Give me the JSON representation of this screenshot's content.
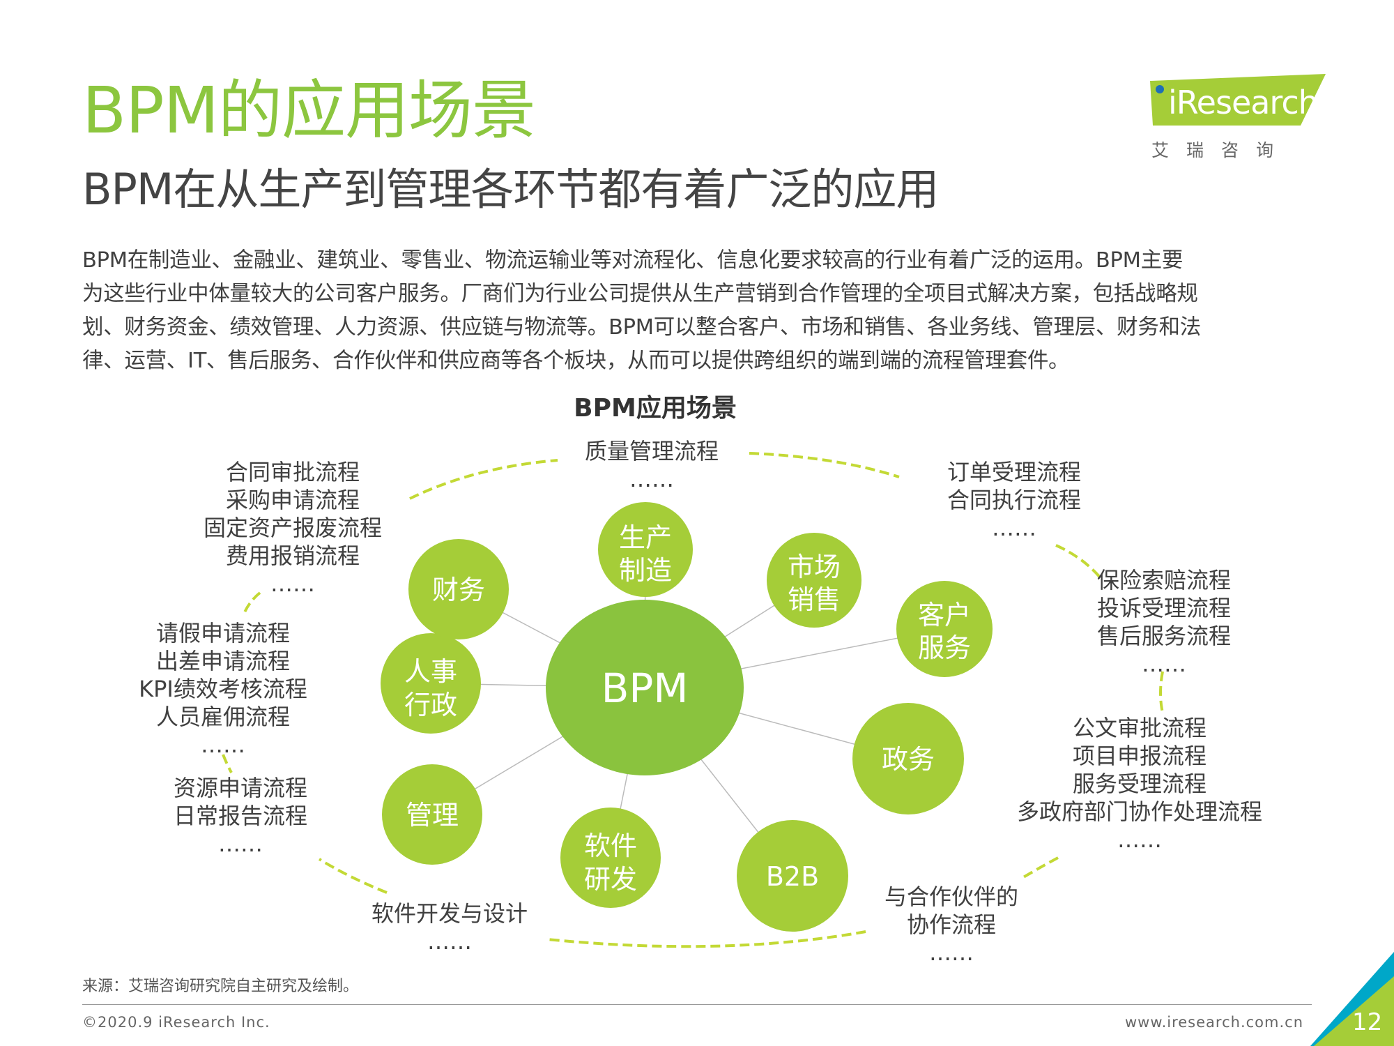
{
  "header": {
    "title": "BPM的应用场景",
    "subtitle": "BPM在从生产到管理各环节都有着广泛的应用"
  },
  "logo": {
    "brand": "iResearch",
    "chinese_name": "艾瑞咨询"
  },
  "body": {
    "lines": [
      "BPM在制造业、金融业、建筑业、零售业、物流运输业等对流程化、信息化要求较高的行业有着广泛的运用。BPM主要",
      "为这些行业中体量较大的公司客户服务。厂商们为行业公司提供从生产营销到合作管理的全项目式解决方案，包括战略规",
      "划、财务资金、绩效管理、人力资源、供应链与物流等。BPM可以整合客户、市场和销售、各业务线、管理层、财务和法",
      "律、运营、IT、售后服务、合作伙伴和供应商等各个板块，从而可以提供跨组织的端到端的流程管理套件。"
    ]
  },
  "diagram": {
    "title": "BPM应用场景",
    "hub": "BPM",
    "nodes": [
      {
        "id": "production",
        "label_lines": [
          "生产",
          "制造"
        ]
      },
      {
        "id": "marketing",
        "label_lines": [
          "市场",
          "销售"
        ]
      },
      {
        "id": "customer",
        "label_lines": [
          "客户",
          "服务"
        ]
      },
      {
        "id": "government",
        "label_lines": [
          "政务"
        ]
      },
      {
        "id": "b2b",
        "label_lines": [
          "B2B"
        ]
      },
      {
        "id": "software",
        "label_lines": [
          "软件",
          "研发"
        ]
      },
      {
        "id": "management",
        "label_lines": [
          "管理"
        ]
      },
      {
        "id": "hr",
        "label_lines": [
          "人事",
          "行政"
        ]
      },
      {
        "id": "finance",
        "label_lines": [
          "财务"
        ]
      }
    ],
    "process_groups": {
      "production": [
        "质量管理流程",
        "……"
      ],
      "marketing": [
        "订单受理流程",
        "合同执行流程",
        "……"
      ],
      "customer": [
        "保险索赔流程",
        "投诉受理流程",
        "售后服务流程",
        "……"
      ],
      "government": [
        "公文审批流程",
        "项目申报流程",
        "服务受理流程",
        "多政府部门协作处理流程",
        "……"
      ],
      "b2b": [
        "与合作伙伴的",
        "协作流程",
        "……"
      ],
      "software": [
        "软件开发与设计",
        "……"
      ],
      "management": [
        "资源申请流程",
        "日常报告流程",
        "……"
      ],
      "hr": [
        "请假申请流程",
        "出差申请流程",
        "KPI绩效考核流程",
        "人员雇佣流程",
        "……"
      ],
      "finance": [
        "合同审批流程",
        "采购申请流程",
        "固定资产报废流程",
        "费用报销流程",
        "……"
      ]
    }
  },
  "footer": {
    "source": "来源：艾瑞咨询研究院自主研究及绘制。",
    "copyright": "©2020.9 iResearch Inc.",
    "website": "www.iresearch.com.cn",
    "page_number": "12"
  },
  "colors": {
    "accent_green": "#8cc63f",
    "node_green": "#a5cd38",
    "hub_green": "#8ac33e",
    "dash_green": "#c3d935",
    "teal": "#00a7c8"
  }
}
